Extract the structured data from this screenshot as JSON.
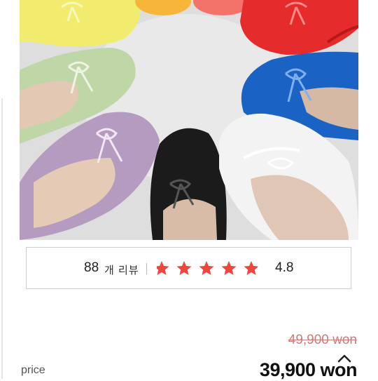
{
  "product": {
    "image_alt": "",
    "colors": {
      "yellow": "#f1ec6e",
      "orange": "#f7b63a",
      "coral": "#f3726a",
      "red": "#e52b2b",
      "blue": "#1a62c4",
      "white": "#f3f3f3",
      "black": "#1b1b1b",
      "lavender": "#b59bc0",
      "mint": "#bfd6a7",
      "background": "#dedede"
    }
  },
  "reviews": {
    "count": "88",
    "label": "개 리뷰",
    "rating": "4.8",
    "stars_filled": 4.8,
    "stars_total": 5,
    "star_color": "#f0453a"
  },
  "price": {
    "label": "price",
    "original": "49,900 won",
    "current": "39,900 won"
  },
  "icons": {
    "scroll_top": "chevron-up-icon",
    "star": "star-icon"
  }
}
